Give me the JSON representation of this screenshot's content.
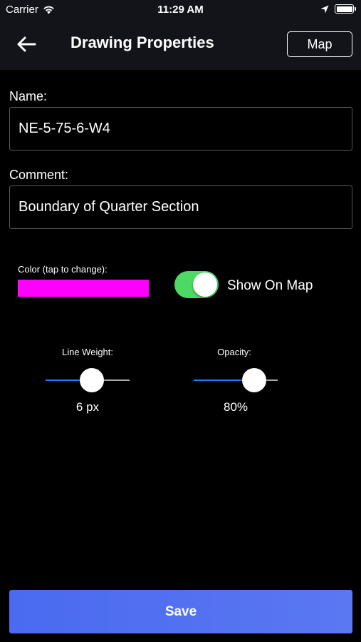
{
  "status_bar": {
    "carrier": "Carrier",
    "time": "11:29 AM",
    "icons": [
      "wifi-icon",
      "location-arrow-icon",
      "battery-icon"
    ]
  },
  "nav": {
    "back_icon": "arrow-left-icon",
    "title": "Drawing Properties",
    "map_label": "Map"
  },
  "form": {
    "name_label": "Name:",
    "name_value": "NE-5-75-6-W4",
    "comment_label": "Comment:",
    "comment_value": "Boundary of Quarter Section"
  },
  "color": {
    "label": "Color (tap to change):",
    "value": "#ff00ff"
  },
  "show_on_map": {
    "label": "Show On Map",
    "on": true,
    "accent": "#4cd964"
  },
  "line_weight": {
    "label": "Line Weight:",
    "value_text": "6 px",
    "fraction": 0.55
  },
  "opacity": {
    "label": "Opacity:",
    "value_text": "80%",
    "fraction": 0.72
  },
  "save_label": "Save",
  "colors": {
    "slider_fill": "#1e7bff",
    "save_button": "#4a6af0",
    "bar_background": "#13141a"
  }
}
